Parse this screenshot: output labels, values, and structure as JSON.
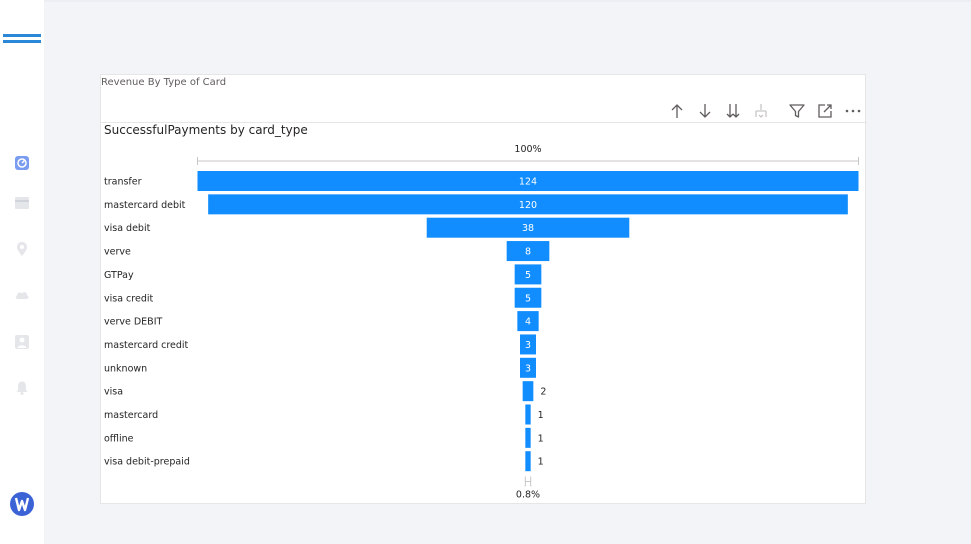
{
  "sidebar": {
    "icons": [
      "menu-icon",
      "dashboard-icon",
      "table-icon",
      "map-pin-icon",
      "cloud-icon",
      "user-icon",
      "bell-icon",
      "logo-icon"
    ]
  },
  "card": {
    "title": "Revenue By Type of Card",
    "toolbar": [
      "sort-ascending-icon",
      "sort-descending-icon",
      "expand-all-down-icon",
      "drill-down-icon",
      "filter-icon",
      "focus-mode-icon",
      "more-options-icon"
    ]
  },
  "colors": {
    "bar": "#118dff",
    "accent": "#2b88d8"
  },
  "chart_data": {
    "type": "funnel",
    "title": "SuccessfulPayments by card_type",
    "top_percent_label": "100%",
    "bottom_percent_label": "0.8%",
    "categories": [
      "transfer",
      "mastercard debit",
      "visa debit",
      "verve",
      "GTPay",
      "visa credit",
      "verve DEBIT",
      "mastercard credit",
      "unknown",
      "visa",
      "mastercard",
      "offline",
      "visa debit-prepaid"
    ],
    "values": [
      124,
      120,
      38,
      8,
      5,
      5,
      4,
      3,
      3,
      2,
      1,
      1,
      1
    ]
  }
}
